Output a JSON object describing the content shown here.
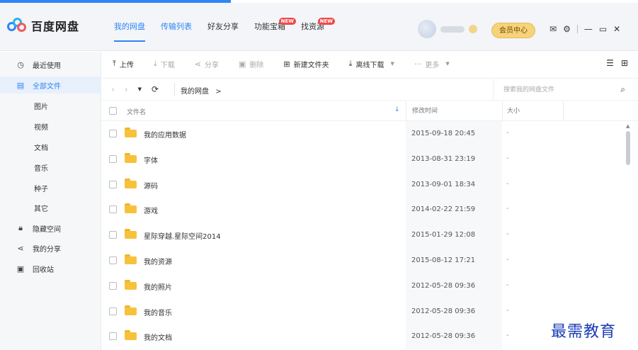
{
  "app": {
    "logo_text": "百度网盘"
  },
  "nav": {
    "tabs": [
      {
        "label": "我的网盘"
      },
      {
        "label": "传输列表"
      },
      {
        "label": "好友分享"
      },
      {
        "label": "功能宝箱",
        "badge": "NEW"
      },
      {
        "label": "找资源",
        "badge": "NEW"
      }
    ]
  },
  "user": {
    "member_label": "会员中心"
  },
  "window": {
    "icons": [
      "mail-icon",
      "settings-icon",
      "minimize-icon",
      "maximize-icon",
      "close-icon"
    ]
  },
  "sidebar": {
    "items": [
      {
        "label": "最近使用",
        "icon": "clock-icon"
      },
      {
        "label": "全部文件",
        "icon": "file-icon"
      },
      {
        "label": "图片"
      },
      {
        "label": "视频"
      },
      {
        "label": "文档"
      },
      {
        "label": "音乐"
      },
      {
        "label": "种子"
      },
      {
        "label": "其它"
      },
      {
        "label": "隐藏空间",
        "icon": "lock-icon"
      },
      {
        "label": "我的分享",
        "icon": "share-icon"
      },
      {
        "label": "回收站",
        "icon": "trash-icon"
      }
    ]
  },
  "toolbar": {
    "upload": "上传",
    "download": "下载",
    "share": "分享",
    "delete": "删除",
    "new_folder": "新建文件夹",
    "offline_download": "离线下载",
    "more": "更多"
  },
  "address": {
    "path": "我的网盘",
    "path_sep": ">",
    "search_placeholder": "搜索我的网盘文件"
  },
  "table": {
    "headers": {
      "name": "文件名",
      "modified": "修改时间",
      "size": "大小"
    },
    "rows": [
      {
        "name": "我的应用数据",
        "modified": "2015-09-18 20:45",
        "size": "-"
      },
      {
        "name": "字体",
        "modified": "2013-08-31 23:19",
        "size": "-"
      },
      {
        "name": "源码",
        "modified": "2013-09-01 18:34",
        "size": "-"
      },
      {
        "name": "游戏",
        "modified": "2014-02-22 21:59",
        "size": "-"
      },
      {
        "name": "星际穿越.星际空间2014",
        "modified": "2015-01-29 12:08",
        "size": "-"
      },
      {
        "name": "我的资源",
        "modified": "2015-08-12 17:21",
        "size": "-"
      },
      {
        "name": "我的照片",
        "modified": "2012-05-28 09:36",
        "size": "-"
      },
      {
        "name": "我的音乐",
        "modified": "2012-05-28 09:36",
        "size": "-"
      },
      {
        "name": "我的文档",
        "modified": "2012-05-28 09:36",
        "size": "-"
      }
    ]
  },
  "watermark": "最需教育",
  "colors": {
    "accent": "#2f86f6",
    "folder": "#f7c23b",
    "member": "#f6d37a",
    "badge": "#f04848"
  }
}
